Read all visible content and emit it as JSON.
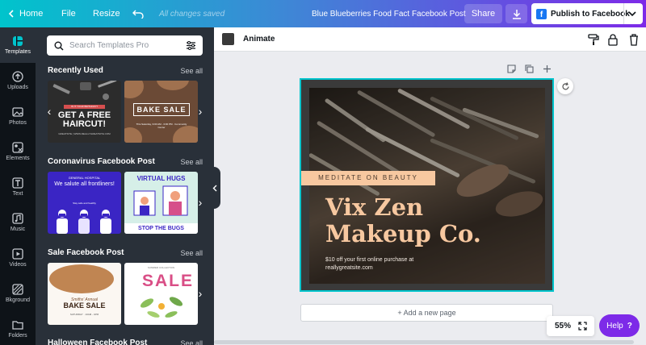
{
  "topbar": {
    "home_label": "Home",
    "file_label": "File",
    "resize_label": "Resize",
    "saved_status": "All changes saved",
    "document_title": "Blue Blueberries Food Fact Facebook Post",
    "share_label": "Share",
    "publish_label": "Publish to Facebook"
  },
  "rail": {
    "items": [
      {
        "label": "Templates",
        "icon": "templates-icon",
        "active": true
      },
      {
        "label": "Uploads",
        "icon": "upload-icon"
      },
      {
        "label": "Photos",
        "icon": "photos-icon"
      },
      {
        "label": "Elements",
        "icon": "elements-icon"
      },
      {
        "label": "Text",
        "icon": "text-icon"
      },
      {
        "label": "Music",
        "icon": "music-icon"
      },
      {
        "label": "Videos",
        "icon": "videos-icon"
      },
      {
        "label": "Bkground",
        "icon": "background-icon"
      },
      {
        "label": "Folders",
        "icon": "folder-icon"
      }
    ]
  },
  "panel": {
    "search_placeholder": "Search Templates Pro",
    "see_all": "See all",
    "sections": [
      {
        "title": "Recently Used",
        "templates": [
          {
            "tag": "IS IT YOUR BIRTHDAY?",
            "headline": "GET A FREE HAIRCUT!",
            "note": "GREATSITE  |  WWW.REALLYGREATSITE.COM"
          },
          {
            "headline": "BAKE SALE",
            "note": "This Saturday, 9:00 AM - 3:00 PM · Community Center"
          }
        ]
      },
      {
        "title": "Coronavirus Facebook Post",
        "templates": [
          {
            "tag": "GENERAL HOSPITAL",
            "headline": "We salute all frontliners!",
            "note": "Stay safe and healthy"
          },
          {
            "headline": "VIRTUAL HUGS",
            "footer": "STOP THE BUGS"
          }
        ]
      },
      {
        "title": "Sale Facebook Post",
        "templates": [
          {
            "script": "Smiths' Annual",
            "headline": "BAKE SALE",
            "note": "SATURDAY · 10AM - 4PM"
          },
          {
            "tag": "SUMMER COLLECTION",
            "headline": "SALE"
          }
        ]
      },
      {
        "title": "Halloween Facebook Post"
      }
    ]
  },
  "editor": {
    "animate_label": "Animate",
    "background_color": "#3a3a3a"
  },
  "design": {
    "tagline": "MEDITATE ON BEAUTY",
    "headline_line1": "Vix Zen",
    "headline_line2": "Makeup Co.",
    "offer_line1": "$10 off your first online purchase at",
    "offer_line2": "reallygreatsite.com",
    "accent_color": "#f7c8a0"
  },
  "canvas": {
    "add_page_label": "+ Add a new page",
    "zoom_level": "55%",
    "help_label": "Help",
    "help_symbol": "?"
  }
}
